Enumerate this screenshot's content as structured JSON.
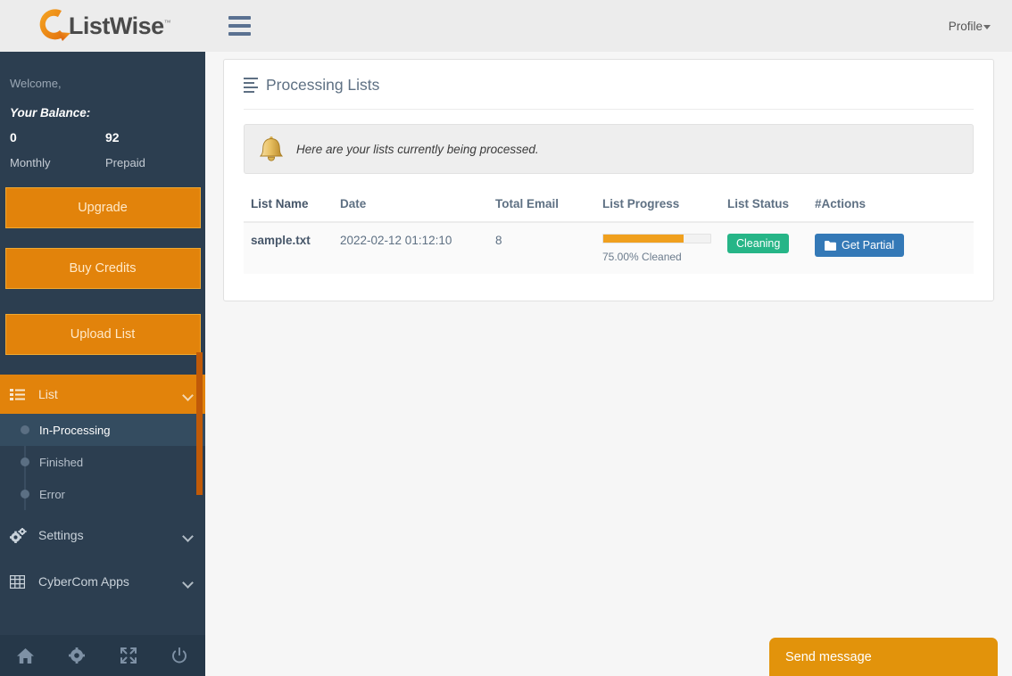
{
  "brand": {
    "name": "ListWise",
    "tm": "™",
    "accent": "#e2830b",
    "sidebar_bg": "#2c3e50",
    "topbar_bg": "#ececec"
  },
  "topbar": {
    "menu_toggle": "hamburger-icon",
    "profile_label": "Profile"
  },
  "sidebar": {
    "welcome": "Welcome,",
    "balance_title": "Your Balance:",
    "balance": [
      {
        "value": "0",
        "label": "Monthly"
      },
      {
        "value": "92",
        "label": "Prepaid"
      }
    ],
    "buttons": [
      {
        "label": "Upgrade",
        "name": "upgrade-button"
      },
      {
        "label": "Buy Credits",
        "name": "buy-credits-button"
      },
      {
        "label": "Upload List",
        "name": "upload-list-button"
      }
    ],
    "nav": [
      {
        "label": "List",
        "icon": "list-icon",
        "active": true,
        "expanded": true,
        "children": [
          {
            "label": "In-Processing",
            "active": true
          },
          {
            "label": "Finished",
            "active": false
          },
          {
            "label": "Error",
            "active": false
          }
        ]
      },
      {
        "label": "Settings",
        "icon": "gears-icon",
        "active": false,
        "expanded": false,
        "children": []
      },
      {
        "label": "CyberCom Apps",
        "icon": "grid-icon",
        "active": false,
        "expanded": false,
        "children": []
      }
    ],
    "footer_icons": [
      "home-icon",
      "gear-icon",
      "expand-icon",
      "power-icon"
    ]
  },
  "main": {
    "panel_title": "Processing Lists",
    "panel_title_icon": "list-lines-icon",
    "alert": {
      "icon": "bell-icon",
      "message": "Here are your lists currently being processed."
    },
    "table": {
      "columns": [
        "List Name",
        "Date",
        "Total Email",
        "List Progress",
        "List Status",
        "#Actions"
      ],
      "rows": [
        {
          "list_name": "sample.txt",
          "date": "2022-02-12 01:12:10",
          "total_email": "8",
          "progress_percent": 75,
          "progress_label": "75.00% Cleaned",
          "status": "Cleaning",
          "status_color": "#26b587",
          "action_label": "Get Partial",
          "action_icon": "folder-icon"
        }
      ]
    }
  },
  "chat": {
    "label": "Send message"
  }
}
